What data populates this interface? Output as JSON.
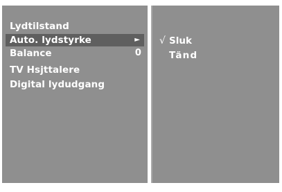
{
  "menu": {
    "items": [
      {
        "label": "Lydtilstand",
        "value": "",
        "arrow": "",
        "selected": false
      },
      {
        "label": "Auto. lydstyrke",
        "value": "",
        "arrow": "►",
        "selected": true
      },
      {
        "label": "Balance",
        "value": "0",
        "arrow": "",
        "selected": false
      },
      {
        "label": "TV Hsjttalere",
        "value": "",
        "arrow": "",
        "selected": false
      },
      {
        "label": "Digital lydudgang",
        "value": "",
        "arrow": "",
        "selected": false
      }
    ]
  },
  "submenu": {
    "options": [
      {
        "check": "√",
        "label": "Sluk",
        "checked": true
      },
      {
        "check": "",
        "label": "Tänd",
        "checked": false
      }
    ]
  },
  "colors": {
    "panel_background": "#8f8f8f",
    "selected_background": "#5f5f5f",
    "text": "#ffffff",
    "divider": "#ffffff"
  }
}
